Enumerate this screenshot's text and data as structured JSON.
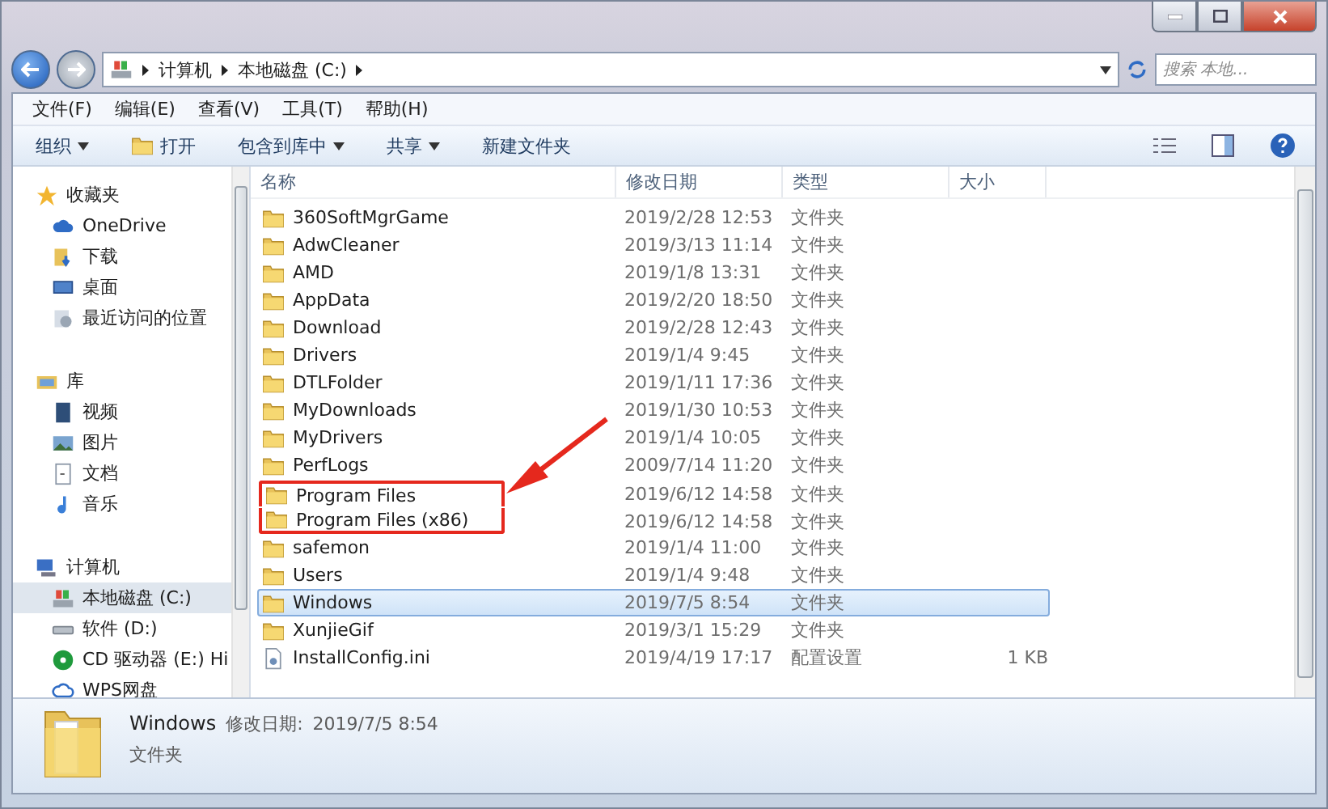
{
  "address_bar": {
    "path": [
      "计算机",
      "本地磁盘 (C:)"
    ],
    "search_placeholder": "搜索 本地..."
  },
  "menu": [
    "文件(F)",
    "编辑(E)",
    "查看(V)",
    "工具(T)",
    "帮助(H)"
  ],
  "toolbar": [
    {
      "label": "组织",
      "kind": "dropdown"
    },
    {
      "label": "打开",
      "kind": "icon"
    },
    {
      "label": "包含到库中",
      "kind": "dropdown"
    },
    {
      "label": "共享",
      "kind": "dropdown"
    },
    {
      "label": "新建文件夹",
      "kind": "plain"
    }
  ],
  "sidebar": [
    {
      "label": "收藏夹",
      "selected": false,
      "children": [
        {
          "label": "OneDrive",
          "selected": false
        },
        {
          "label": "下载",
          "selected": false
        },
        {
          "label": "桌面",
          "selected": false
        },
        {
          "label": "最近访问的位置",
          "selected": false
        }
      ]
    },
    {
      "label": "库",
      "selected": false,
      "children": [
        {
          "label": "视频",
          "selected": false
        },
        {
          "label": "图片",
          "selected": false
        },
        {
          "label": "文档",
          "selected": false
        },
        {
          "label": "音乐",
          "selected": false
        }
      ]
    },
    {
      "label": "计算机",
      "selected": false,
      "children": [
        {
          "label": "本地磁盘 (C:)",
          "selected": true
        },
        {
          "label": "软件 (D:)",
          "selected": false
        },
        {
          "label": "CD 驱动器 (E:) Hi",
          "selected": false
        },
        {
          "label": "WPS网盘",
          "selected": false
        }
      ]
    }
  ],
  "table": {
    "columns": [
      "名称",
      "修改日期",
      "类型",
      "大小"
    ],
    "rows": [
      {
        "name": "360SoftMgrGame",
        "date": "2019/2/28 12:53",
        "type": "文件夹",
        "kind": "folder",
        "selected": false,
        "boxed": false
      },
      {
        "name": "AdwCleaner",
        "date": "2019/3/13 11:14",
        "type": "文件夹",
        "kind": "folder",
        "selected": false,
        "boxed": false
      },
      {
        "name": "AMD",
        "date": "2019/1/8 13:31",
        "type": "文件夹",
        "kind": "folder",
        "selected": false,
        "boxed": false
      },
      {
        "name": "AppData",
        "date": "2019/2/20 18:50",
        "type": "文件夹",
        "kind": "folder",
        "selected": false,
        "boxed": false
      },
      {
        "name": "Download",
        "date": "2019/2/28 12:43",
        "type": "文件夹",
        "kind": "folder",
        "selected": false,
        "boxed": false
      },
      {
        "name": "Drivers",
        "date": "2019/1/4 9:45",
        "type": "文件夹",
        "kind": "folder",
        "selected": false,
        "boxed": false
      },
      {
        "name": "DTLFolder",
        "date": "2019/1/11 17:36",
        "type": "文件夹",
        "kind": "folder",
        "selected": false,
        "boxed": false
      },
      {
        "name": "MyDownloads",
        "date": "2019/1/30 10:53",
        "type": "文件夹",
        "kind": "folder",
        "selected": false,
        "boxed": false
      },
      {
        "name": "MyDrivers",
        "date": "2019/1/4 10:05",
        "type": "文件夹",
        "kind": "folder",
        "selected": false,
        "boxed": false
      },
      {
        "name": "PerfLogs",
        "date": "2009/7/14 11:20",
        "type": "文件夹",
        "kind": "folder",
        "selected": false,
        "boxed": false
      },
      {
        "name": "Program Files",
        "date": "2019/6/12 14:58",
        "type": "文件夹",
        "kind": "folder",
        "selected": false,
        "boxed": true
      },
      {
        "name": "Program Files (x86)",
        "date": "2019/6/12 14:58",
        "type": "文件夹",
        "kind": "folder",
        "selected": false,
        "boxed": true
      },
      {
        "name": "safemon",
        "date": "2019/1/4 11:00",
        "type": "文件夹",
        "kind": "folder",
        "selected": false,
        "boxed": false
      },
      {
        "name": "Users",
        "date": "2019/1/4 9:48",
        "type": "文件夹",
        "kind": "folder",
        "selected": false,
        "boxed": false
      },
      {
        "name": "Windows",
        "date": "2019/7/5 8:54",
        "type": "文件夹",
        "kind": "folder",
        "selected": true,
        "boxed": false
      },
      {
        "name": "XunjieGif",
        "date": "2019/3/1 15:29",
        "type": "文件夹",
        "kind": "folder",
        "selected": false,
        "boxed": false
      },
      {
        "name": "InstallConfig.ini",
        "date": "2019/4/19 17:17",
        "type": "配置设置",
        "size": "1 KB",
        "kind": "file",
        "selected": false,
        "boxed": false
      }
    ]
  },
  "details": {
    "name": "Windows",
    "date_label": "修改日期:",
    "date": "2019/7/5 8:54",
    "type": "文件夹"
  }
}
